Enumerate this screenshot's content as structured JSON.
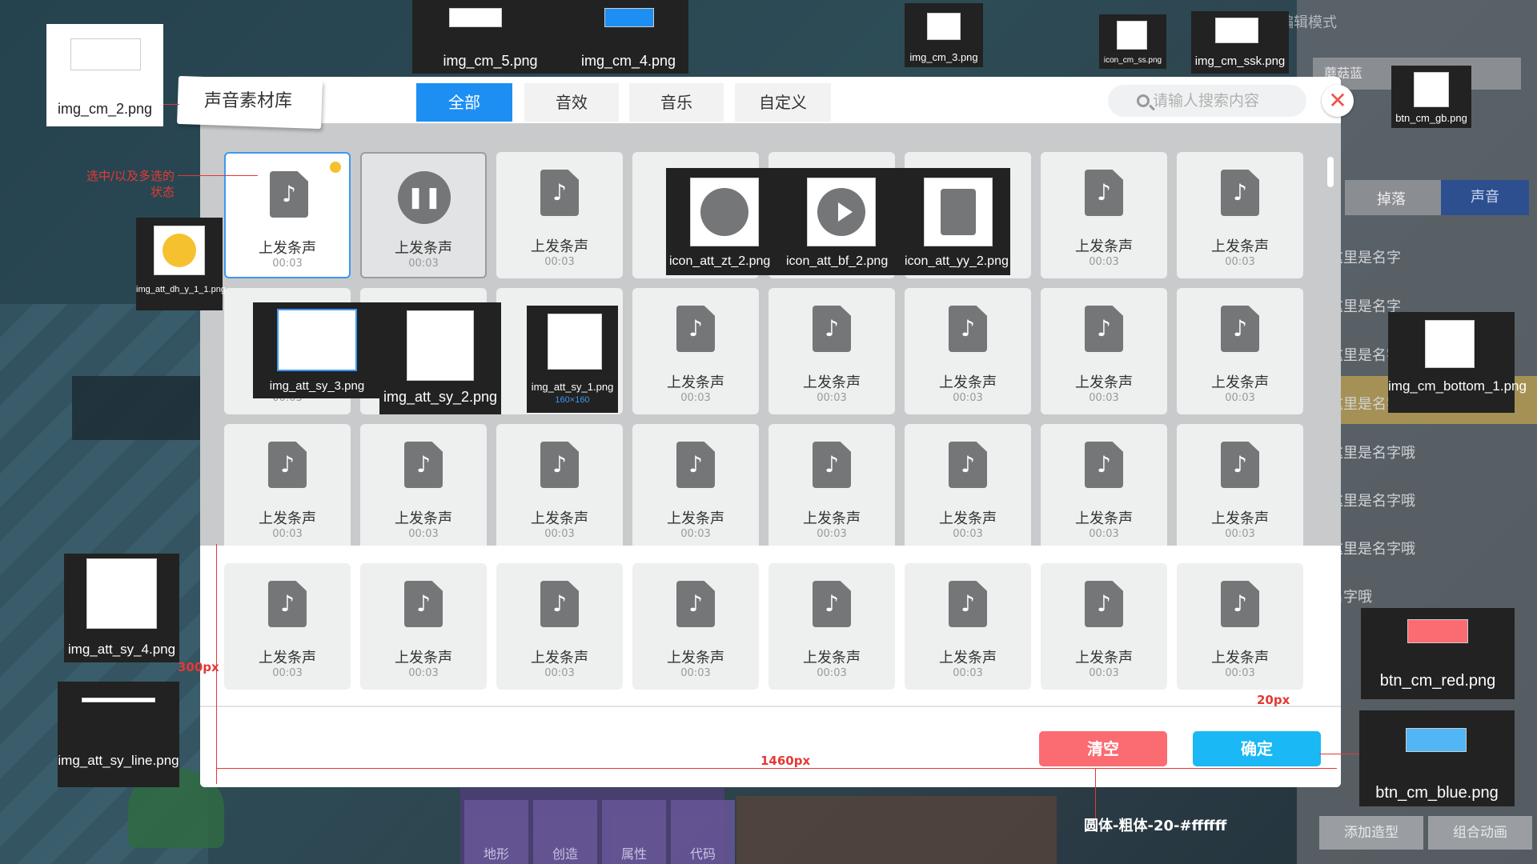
{
  "modal": {
    "title": "声音素材库",
    "tabs": [
      {
        "label": "全部",
        "active": true
      },
      {
        "label": "音效",
        "active": false
      },
      {
        "label": "音乐",
        "active": false
      },
      {
        "label": "自定义",
        "active": false
      }
    ],
    "search_placeholder": "请输人搜索内容",
    "close_symbol": "✕",
    "clear_button": "清空",
    "confirm_button": "确定"
  },
  "cards": {
    "name": "上发条声",
    "duration": "00:03",
    "note_glyph": "♪",
    "pause_glyph": "❚❚"
  },
  "background": {
    "edit_mode": "编辑模式",
    "panel_input": "蘑菇蓝",
    "panel_tab_left": "掉落",
    "panel_tab_right": "声音",
    "panel_rows": [
      "这里是名字",
      "这里是名字",
      "这里是名字",
      "这里是名字",
      "这里是名字哦",
      "这里是名字哦",
      "这里是名字哦",
      "名字哦"
    ],
    "bottom_tiles": [
      "地形",
      "创造",
      "属性",
      "代码"
    ],
    "panel_buttons": [
      "添加造型",
      "组合动画"
    ]
  },
  "annotations": {
    "img_cm_2": "img_cm_2.png",
    "img_cm_5": "img_cm_5.png",
    "img_cm_4": "img_cm_4.png",
    "img_cm_3": "img_cm_3.png",
    "icon_cm_ss": "icon_cm_ss.png",
    "img_cm_ssk": "img_cm_ssk.png",
    "btn_cm_gb": "btn_cm_gb.png",
    "selected_state": "选中/以及多选的状态",
    "img_att_dh_y_1_1": "img_att_dh_y_1_1.png",
    "icon_att_zt_2": "icon_att_zt_2.png",
    "icon_att_bf_2": "icon_att_bf_2.png",
    "icon_att_yy_2": "icon_att_yy_2.png",
    "img_att_sy_3": "img_att_sy_3.png",
    "img_att_sy_2": "img_att_sy_2.png",
    "img_att_sy_1": "img_att_sy_1.png",
    "img_att_sy_1_size": "160×160",
    "img_cm_bottom_1": "img_cm_bottom_1.png",
    "img_att_sy_4": "img_att_sy_4.png",
    "img_att_sy_line": "img_att_sy_line.png",
    "btn_cm_red": "btn_cm_red.png",
    "btn_cm_blue": "btn_cm_blue.png",
    "dim_300": "300px",
    "dim_20": "20px",
    "dim_1460": "1460px",
    "font_note": "圆体-粗体-20-#ffffff"
  }
}
